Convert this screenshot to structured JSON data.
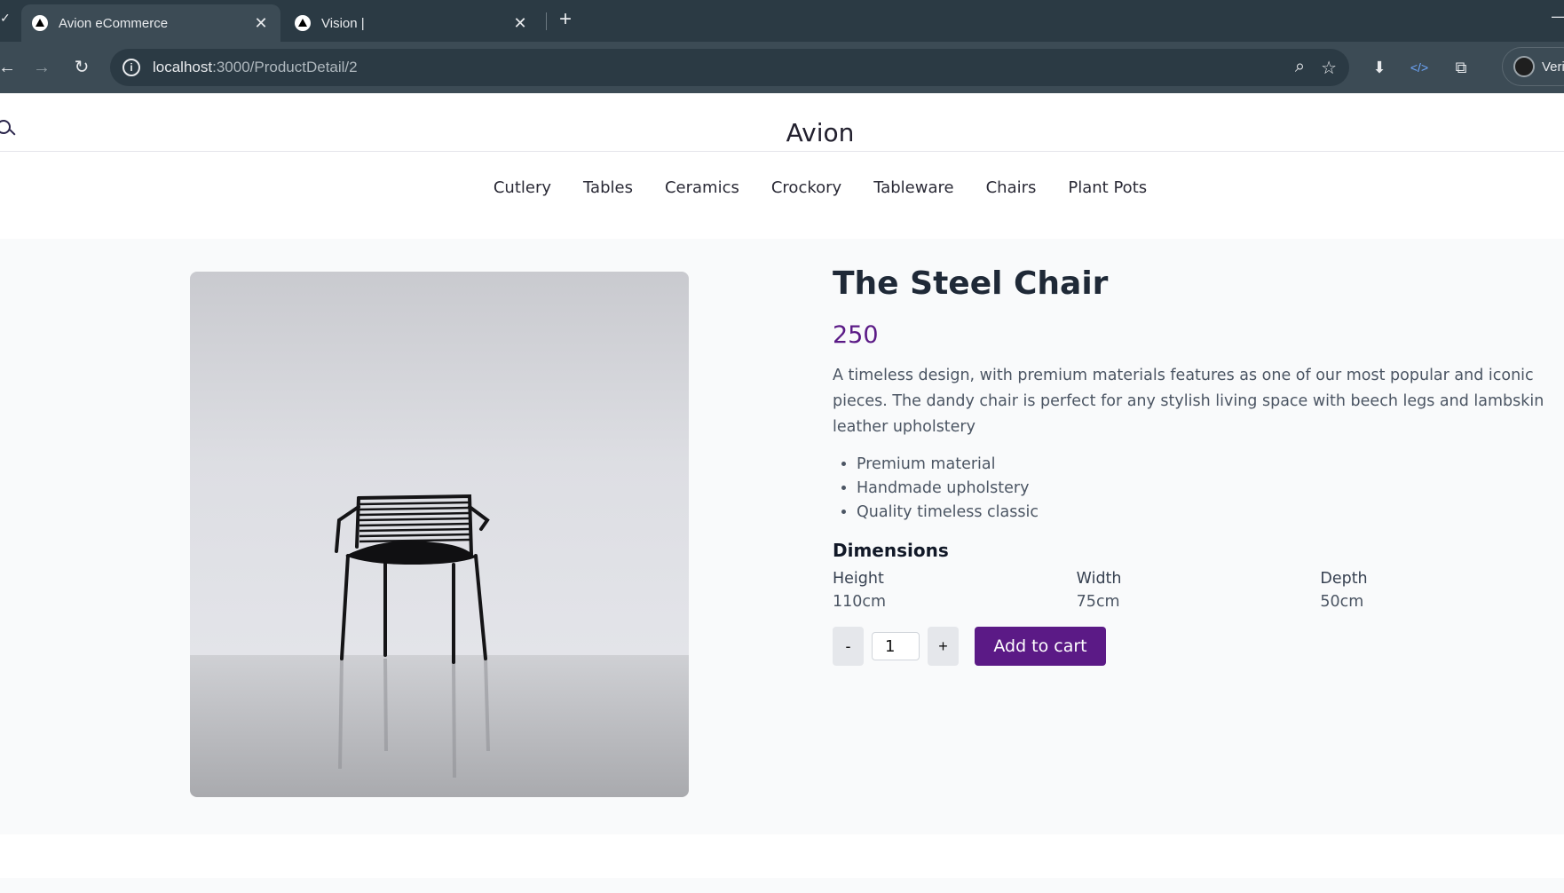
{
  "browser": {
    "tabs": [
      {
        "title": "Avion eCommerce",
        "active": true
      },
      {
        "title": "Vision |",
        "active": false
      }
    ],
    "url_host": "localhost",
    "url_path": ":3000/ProductDetail/2",
    "profile_label": "Veri"
  },
  "site": {
    "brand": "Avion",
    "nav": [
      "Cutlery",
      "Tables",
      "Ceramics",
      "Crockory",
      "Tableware",
      "Chairs",
      "Plant Pots"
    ]
  },
  "product": {
    "title": "The Steel Chair",
    "price": "250",
    "description": "A timeless design, with premium materials features as one of our most popular and iconic pieces. The dandy chair is perfect for any stylish living space with beech legs and lambskin leather upholstery",
    "features": [
      "Premium material",
      "Handmade upholstery",
      "Quality timeless classic"
    ],
    "dimensions_title": "Dimensions",
    "dimensions": [
      {
        "label": "Height",
        "value": "110cm"
      },
      {
        "label": "Width",
        "value": "75cm"
      },
      {
        "label": "Depth",
        "value": "50cm"
      }
    ],
    "quantity": "1",
    "minus_label": "-",
    "plus_label": "+",
    "add_to_cart": "Add to cart"
  },
  "colors": {
    "accent": "#5b1a86",
    "chrome_dark": "#2b3a44",
    "chrome_toolbar": "#3c4b55",
    "section_bg": "#f9fafb"
  },
  "icons": {
    "search": "search-icon",
    "close": "close-icon",
    "back": "back-arrow-icon",
    "forward": "forward-arrow-icon",
    "reload": "reload-icon",
    "info": "site-info-icon",
    "zoom": "zoom-icon",
    "star": "bookmark-star-icon",
    "extensions": "puzzle-icon"
  }
}
